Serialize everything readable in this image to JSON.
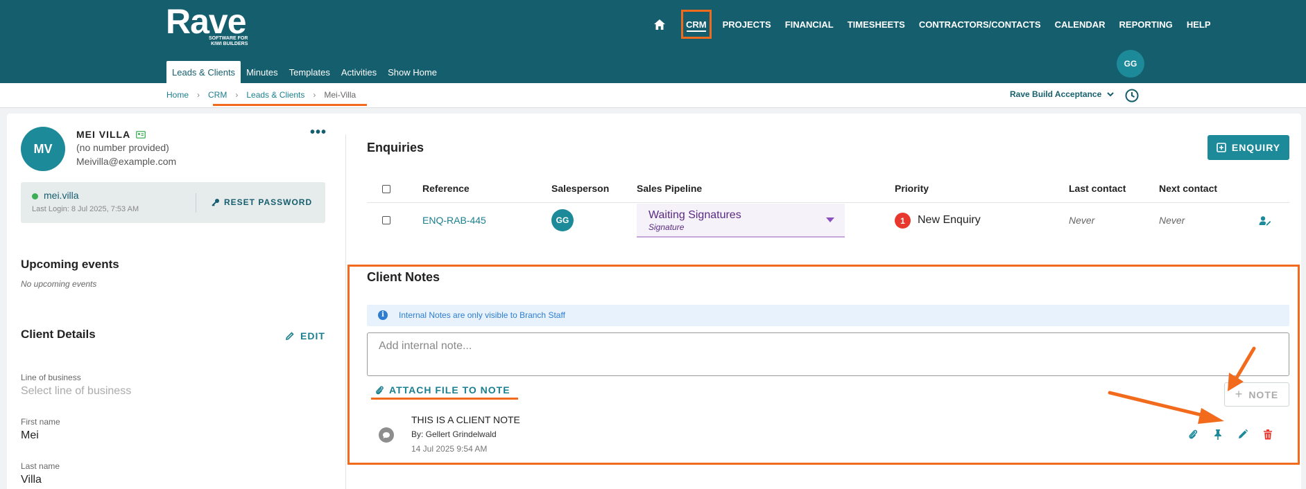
{
  "app": {
    "logo_word": "Rave",
    "logo_sub_line1": "SOFTWARE FOR",
    "logo_sub_line2": "KIWI BUILDERS",
    "colors": {
      "header": "#155e6e",
      "accent": "#1d8a9a",
      "highlight": "#f26b1d",
      "priority_red": "#e8382e"
    }
  },
  "main_nav": {
    "home_icon": "home-icon",
    "items": [
      "CRM",
      "PROJECTS",
      "FINANCIAL",
      "TIMESHEETS",
      "CONTRACTORS/CONTACTS",
      "CALENDAR",
      "REPORTING",
      "HELP"
    ],
    "active": "CRM"
  },
  "user": {
    "initials": "GG"
  },
  "sub_nav": {
    "items": [
      "Leads & Clients",
      "Minutes",
      "Templates",
      "Activities",
      "Show Home"
    ],
    "active": "Leads & Clients"
  },
  "breadcrumb": [
    "Home",
    "CRM",
    "Leads & Clients",
    "Mei-Villa"
  ],
  "company": {
    "name": "Rave Build Acceptance"
  },
  "client": {
    "initials": "MV",
    "name": "MEI VILLA",
    "phone": "(no number provided)",
    "email": "Meivilla@example.com",
    "username": "mei.villa",
    "last_login": "Last Login: 8 Jul 2025, 7:53 AM",
    "reset_label": "RESET PASSWORD"
  },
  "upcoming": {
    "title": "Upcoming events",
    "empty": "No upcoming events"
  },
  "details": {
    "title": "Client Details",
    "edit_label": "EDIT",
    "fields": [
      {
        "label": "Line of business",
        "value": "Select line of business"
      },
      {
        "label": "First name",
        "value": "Mei"
      },
      {
        "label": "Last name",
        "value": "Villa"
      }
    ]
  },
  "enquiries": {
    "title": "Enquiries",
    "add_label": "ENQUIRY",
    "columns": [
      "Reference",
      "Salesperson",
      "Sales Pipeline",
      "Priority",
      "Last contact",
      "Next contact"
    ],
    "rows": [
      {
        "reference": "ENQ-RAB-445",
        "salesperson": "GG",
        "pipeline": "Waiting Signatures",
        "pipeline_sub": "Signature",
        "priority_num": "1",
        "priority": "New Enquiry",
        "last_contact": "Never",
        "next_contact": "Never"
      }
    ]
  },
  "notes": {
    "title": "Client Notes",
    "info": "Internal Notes are only visible to Branch Staff",
    "placeholder": "Add internal note...",
    "attach_label": "ATTACH FILE TO NOTE",
    "add_label": "NOTE",
    "items": [
      {
        "title": "THIS IS A CLIENT NOTE",
        "by": "By: Gellert Grindelwald",
        "date": "14 Jul 2025 9:54 AM"
      }
    ]
  }
}
